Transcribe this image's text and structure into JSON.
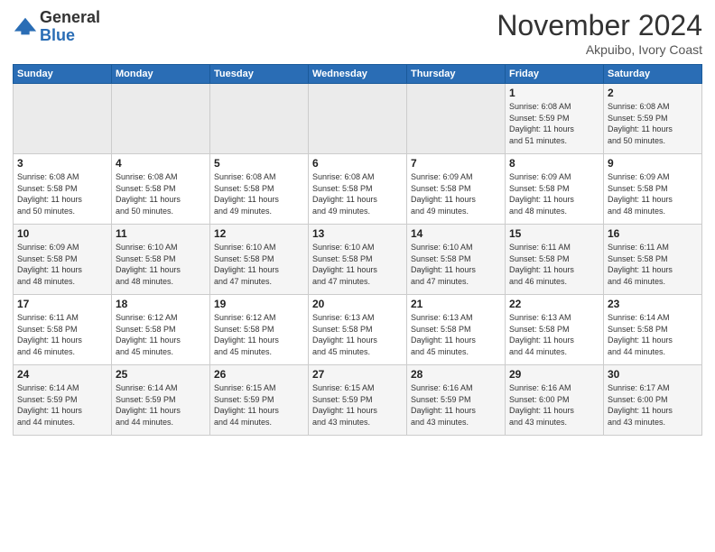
{
  "header": {
    "logo_general": "General",
    "logo_blue": "Blue",
    "month_title": "November 2024",
    "location": "Akpuibo, Ivory Coast"
  },
  "days_of_week": [
    "Sunday",
    "Monday",
    "Tuesday",
    "Wednesday",
    "Thursday",
    "Friday",
    "Saturday"
  ],
  "weeks": [
    [
      {
        "day": "",
        "info": ""
      },
      {
        "day": "",
        "info": ""
      },
      {
        "day": "",
        "info": ""
      },
      {
        "day": "",
        "info": ""
      },
      {
        "day": "",
        "info": ""
      },
      {
        "day": "1",
        "info": "Sunrise: 6:08 AM\nSunset: 5:59 PM\nDaylight: 11 hours\nand 51 minutes."
      },
      {
        "day": "2",
        "info": "Sunrise: 6:08 AM\nSunset: 5:59 PM\nDaylight: 11 hours\nand 50 minutes."
      }
    ],
    [
      {
        "day": "3",
        "info": "Sunrise: 6:08 AM\nSunset: 5:58 PM\nDaylight: 11 hours\nand 50 minutes."
      },
      {
        "day": "4",
        "info": "Sunrise: 6:08 AM\nSunset: 5:58 PM\nDaylight: 11 hours\nand 50 minutes."
      },
      {
        "day": "5",
        "info": "Sunrise: 6:08 AM\nSunset: 5:58 PM\nDaylight: 11 hours\nand 49 minutes."
      },
      {
        "day": "6",
        "info": "Sunrise: 6:08 AM\nSunset: 5:58 PM\nDaylight: 11 hours\nand 49 minutes."
      },
      {
        "day": "7",
        "info": "Sunrise: 6:09 AM\nSunset: 5:58 PM\nDaylight: 11 hours\nand 49 minutes."
      },
      {
        "day": "8",
        "info": "Sunrise: 6:09 AM\nSunset: 5:58 PM\nDaylight: 11 hours\nand 48 minutes."
      },
      {
        "day": "9",
        "info": "Sunrise: 6:09 AM\nSunset: 5:58 PM\nDaylight: 11 hours\nand 48 minutes."
      }
    ],
    [
      {
        "day": "10",
        "info": "Sunrise: 6:09 AM\nSunset: 5:58 PM\nDaylight: 11 hours\nand 48 minutes."
      },
      {
        "day": "11",
        "info": "Sunrise: 6:10 AM\nSunset: 5:58 PM\nDaylight: 11 hours\nand 48 minutes."
      },
      {
        "day": "12",
        "info": "Sunrise: 6:10 AM\nSunset: 5:58 PM\nDaylight: 11 hours\nand 47 minutes."
      },
      {
        "day": "13",
        "info": "Sunrise: 6:10 AM\nSunset: 5:58 PM\nDaylight: 11 hours\nand 47 minutes."
      },
      {
        "day": "14",
        "info": "Sunrise: 6:10 AM\nSunset: 5:58 PM\nDaylight: 11 hours\nand 47 minutes."
      },
      {
        "day": "15",
        "info": "Sunrise: 6:11 AM\nSunset: 5:58 PM\nDaylight: 11 hours\nand 46 minutes."
      },
      {
        "day": "16",
        "info": "Sunrise: 6:11 AM\nSunset: 5:58 PM\nDaylight: 11 hours\nand 46 minutes."
      }
    ],
    [
      {
        "day": "17",
        "info": "Sunrise: 6:11 AM\nSunset: 5:58 PM\nDaylight: 11 hours\nand 46 minutes."
      },
      {
        "day": "18",
        "info": "Sunrise: 6:12 AM\nSunset: 5:58 PM\nDaylight: 11 hours\nand 45 minutes."
      },
      {
        "day": "19",
        "info": "Sunrise: 6:12 AM\nSunset: 5:58 PM\nDaylight: 11 hours\nand 45 minutes."
      },
      {
        "day": "20",
        "info": "Sunrise: 6:13 AM\nSunset: 5:58 PM\nDaylight: 11 hours\nand 45 minutes."
      },
      {
        "day": "21",
        "info": "Sunrise: 6:13 AM\nSunset: 5:58 PM\nDaylight: 11 hours\nand 45 minutes."
      },
      {
        "day": "22",
        "info": "Sunrise: 6:13 AM\nSunset: 5:58 PM\nDaylight: 11 hours\nand 44 minutes."
      },
      {
        "day": "23",
        "info": "Sunrise: 6:14 AM\nSunset: 5:58 PM\nDaylight: 11 hours\nand 44 minutes."
      }
    ],
    [
      {
        "day": "24",
        "info": "Sunrise: 6:14 AM\nSunset: 5:59 PM\nDaylight: 11 hours\nand 44 minutes."
      },
      {
        "day": "25",
        "info": "Sunrise: 6:14 AM\nSunset: 5:59 PM\nDaylight: 11 hours\nand 44 minutes."
      },
      {
        "day": "26",
        "info": "Sunrise: 6:15 AM\nSunset: 5:59 PM\nDaylight: 11 hours\nand 44 minutes."
      },
      {
        "day": "27",
        "info": "Sunrise: 6:15 AM\nSunset: 5:59 PM\nDaylight: 11 hours\nand 43 minutes."
      },
      {
        "day": "28",
        "info": "Sunrise: 6:16 AM\nSunset: 5:59 PM\nDaylight: 11 hours\nand 43 minutes."
      },
      {
        "day": "29",
        "info": "Sunrise: 6:16 AM\nSunset: 6:00 PM\nDaylight: 11 hours\nand 43 minutes."
      },
      {
        "day": "30",
        "info": "Sunrise: 6:17 AM\nSunset: 6:00 PM\nDaylight: 11 hours\nand 43 minutes."
      }
    ]
  ]
}
